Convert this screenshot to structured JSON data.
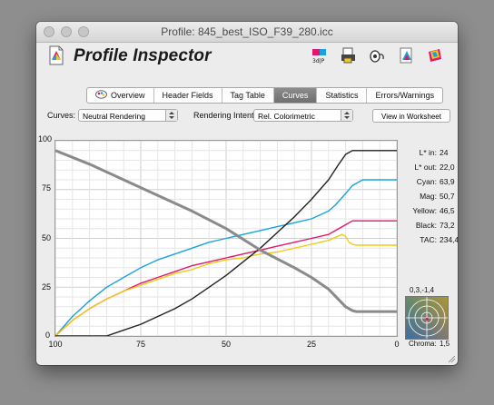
{
  "window": {
    "title": "Profile: 845_best_ISO_F39_280.icc"
  },
  "app": {
    "title": "Profile Inspector"
  },
  "tabs": [
    {
      "label": "Overview",
      "active": false
    },
    {
      "label": "Header Fields",
      "active": false
    },
    {
      "label": "Tag Table",
      "active": false
    },
    {
      "label": "Curves",
      "active": true
    },
    {
      "label": "Statistics",
      "active": false
    },
    {
      "label": "Errors/Warnings",
      "active": false
    }
  ],
  "controls": {
    "curves_label": "Curves:",
    "curves_value": "Neutral Rendering",
    "intent_label": "Rendering Intent:",
    "intent_value": "Rel. Colorimetric",
    "worksheet_button": "View in Worksheet"
  },
  "readout": [
    {
      "label": "L* in:",
      "value": "24"
    },
    {
      "label": "L* out:",
      "value": "22,0"
    },
    {
      "label": "Cyan:",
      "value": "63,9"
    },
    {
      "label": "Mag:",
      "value": "50,7"
    },
    {
      "label": "Yellow:",
      "value": "46,5"
    },
    {
      "label": "Black:",
      "value": "73,2"
    },
    {
      "label": "TAC:",
      "value": "234,4"
    }
  ],
  "chroma": {
    "ab_label": "0,3,-1,4",
    "label": "Chroma:",
    "value": "1,5"
  },
  "colors": {
    "cyan": "#1ba2dc",
    "magenta": "#e2166c",
    "yellow": "#f4c914",
    "black": "#222222",
    "lstar": "#8a8a8a"
  },
  "chart_data": {
    "type": "line",
    "x_axis": {
      "range": [
        100,
        0
      ],
      "ticks": [
        "100",
        "75",
        "50",
        "25",
        "0"
      ]
    },
    "y_axis": {
      "range": [
        0,
        100
      ],
      "ticks": [
        "0",
        "25",
        "50",
        "75",
        "100"
      ]
    },
    "grid": true,
    "series": [
      {
        "name": "Cyan",
        "color": "#1ba2dc",
        "x": [
          100,
          95,
          90,
          85,
          80,
          75,
          70,
          65,
          60,
          55,
          50,
          45,
          40,
          35,
          30,
          25,
          20,
          18,
          15,
          13,
          10,
          5,
          0
        ],
        "y": [
          0,
          10,
          18,
          25,
          30,
          35,
          39,
          42,
          45,
          48,
          50,
          52,
          54,
          56,
          58,
          60,
          64,
          67,
          73,
          77,
          80,
          80,
          80
        ]
      },
      {
        "name": "Mag",
        "color": "#e2166c",
        "x": [
          100,
          95,
          90,
          85,
          80,
          75,
          70,
          65,
          60,
          55,
          50,
          45,
          40,
          35,
          30,
          25,
          20,
          18,
          15,
          13,
          10,
          5,
          0
        ],
        "y": [
          0,
          8,
          14,
          19,
          23,
          27,
          30,
          33,
          36,
          38,
          40,
          42,
          44,
          46,
          48,
          50,
          52,
          54,
          57,
          59,
          59,
          59,
          59
        ]
      },
      {
        "name": "Yellow",
        "color": "#f4c914",
        "x": [
          100,
          95,
          90,
          85,
          80,
          75,
          70,
          65,
          60,
          55,
          50,
          45,
          40,
          35,
          30,
          25,
          20,
          16,
          15,
          14,
          13,
          12,
          10,
          5,
          0
        ],
        "y": [
          0,
          8,
          14,
          19,
          23,
          26,
          29,
          32,
          34,
          37,
          39,
          40,
          42,
          43,
          45,
          47,
          49,
          52,
          51,
          48,
          47,
          46.5,
          46.5,
          46.5,
          46.5
        ]
      },
      {
        "name": "Black",
        "color": "#222222",
        "x": [
          100,
          90,
          85,
          80,
          75,
          70,
          65,
          60,
          55,
          50,
          45,
          40,
          35,
          30,
          25,
          20,
          17,
          15,
          13,
          10,
          5,
          0
        ],
        "y": [
          0,
          0,
          0,
          3,
          6,
          10,
          14,
          19,
          25,
          31,
          38,
          45,
          53,
          61,
          70,
          80,
          88,
          93,
          95,
          95,
          95,
          95
        ]
      },
      {
        "name": "L*",
        "color": "#8a8a8a",
        "x": [
          100,
          90,
          80,
          70,
          60,
          50,
          40,
          30,
          25,
          20,
          15,
          13,
          12,
          10,
          5,
          0
        ],
        "y": [
          95,
          88,
          80,
          72,
          64,
          55,
          44,
          35,
          30,
          24,
          15,
          13,
          12.5,
          12.5,
          12.5,
          12.5
        ]
      }
    ]
  }
}
